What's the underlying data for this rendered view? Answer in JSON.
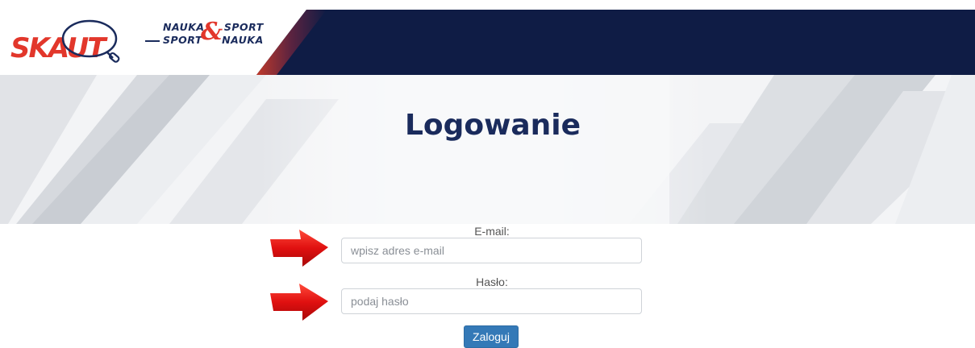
{
  "header": {
    "logo_text": "SKAUT",
    "tagline": {
      "line1_left": "NAUKA",
      "line1_right": "SPORT",
      "line2_left": "SPORT",
      "line2_right": "NAUKA",
      "ampersand": "&"
    },
    "colors": {
      "navy": "#0f1c45",
      "brand_red": "#e2372b"
    }
  },
  "page": {
    "title": "Logowanie"
  },
  "form": {
    "email": {
      "label": "E-mail:",
      "placeholder": "wpisz adres e-mail",
      "value": ""
    },
    "password": {
      "label": "Hasło:",
      "placeholder": "podaj hasło",
      "value": ""
    },
    "submit_label": "Zaloguj",
    "button_color": "#3479b7"
  },
  "annotations": {
    "arrow_color": "#e01010",
    "arrow_icon": "red-arrow-icon"
  }
}
